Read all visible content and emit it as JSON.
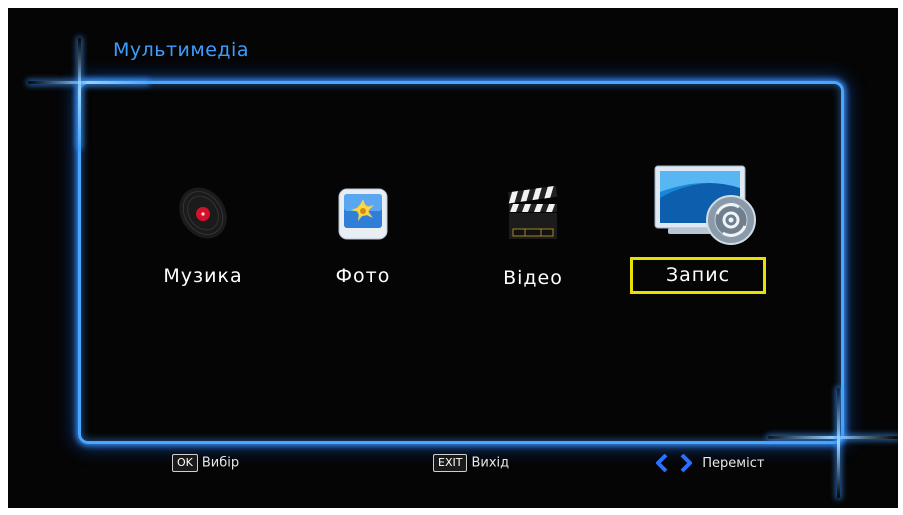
{
  "header": {
    "title": "Мультимедіа"
  },
  "menu": {
    "items": [
      {
        "label": "Музика",
        "icon": "vinyl-record-icon",
        "selected": false
      },
      {
        "label": "Фото",
        "icon": "photo-icon",
        "selected": false
      },
      {
        "label": "Відео",
        "icon": "clapperboard-icon",
        "selected": false
      },
      {
        "label": "Запис",
        "icon": "record-monitor-icon",
        "selected": true
      }
    ]
  },
  "footer": {
    "ok_key": "OK",
    "ok_label": "Вибір",
    "exit_key": "EXIT",
    "exit_label": "Вихід",
    "move_label": "Переміст"
  },
  "colors": {
    "background": "#050505",
    "frame": "#48a8ff",
    "title": "#3d9dff",
    "selection": "#e8e000",
    "arrow": "#2a6fff"
  }
}
